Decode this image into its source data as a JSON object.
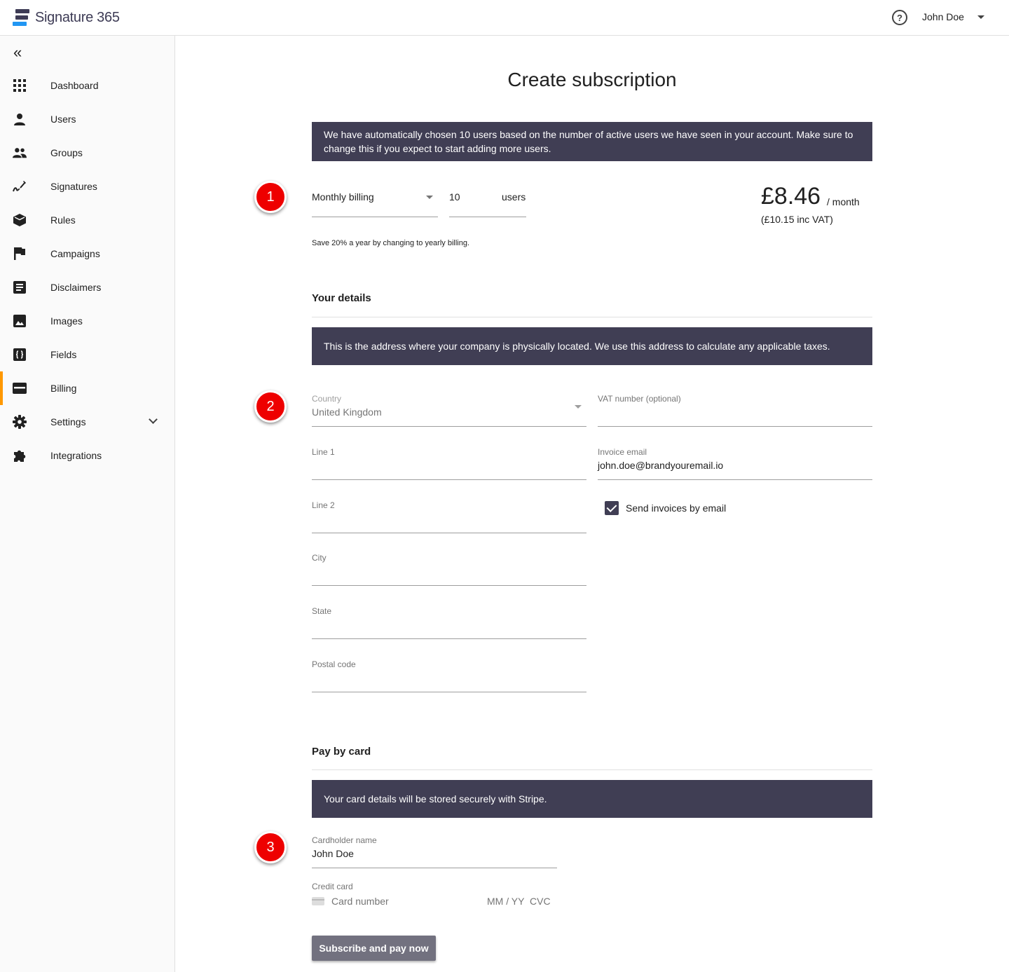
{
  "app": {
    "name": "Signature 365"
  },
  "header": {
    "user_name": "John Doe",
    "help_glyph": "?"
  },
  "sidebar": {
    "collapse_glyph": "«",
    "items": [
      {
        "label": "Dashboard",
        "icon": "grid-icon"
      },
      {
        "label": "Users",
        "icon": "person-icon"
      },
      {
        "label": "Groups",
        "icon": "people-icon"
      },
      {
        "label": "Signatures",
        "icon": "signature-icon"
      },
      {
        "label": "Rules",
        "icon": "box-icon"
      },
      {
        "label": "Campaigns",
        "icon": "flag-icon"
      },
      {
        "label": "Disclaimers",
        "icon": "document-icon"
      },
      {
        "label": "Images",
        "icon": "image-icon"
      },
      {
        "label": "Fields",
        "icon": "braces-icon"
      },
      {
        "label": "Billing",
        "icon": "credit-card-icon",
        "active": true
      },
      {
        "label": "Settings",
        "icon": "gear-icon",
        "expandable": true
      },
      {
        "label": "Integrations",
        "icon": "puzzle-icon"
      }
    ],
    "active_accent": "#ff9800"
  },
  "page": {
    "title": "Create subscription",
    "steps": [
      "1",
      "2",
      "3"
    ],
    "users_banner": "We have automatically chosen 10 users based on the number of active users we have seen in your account. Make sure to change this if you expect to start adding more users.",
    "billing": {
      "period_value": "Monthly billing",
      "users_count": "10",
      "users_suffix": "users",
      "price": "£8.46",
      "per_month": "/ month",
      "inc_vat": "(£10.15 inc VAT)",
      "save_note": "Save 20% a year by changing to yearly billing."
    },
    "details": {
      "title": "Your details",
      "banner": "This is the address where your company is physically located. We use this address to calculate any applicable taxes.",
      "country_label": "Country",
      "country_value": "United Kingdom",
      "vat_label": "VAT number (optional)",
      "line1_label": "Line 1",
      "invoice_email_label": "Invoice email",
      "invoice_email_value": "john.doe@brandyouremail.io",
      "line2_label": "Line 2",
      "send_invoices_label": "Send invoices by email",
      "send_invoices_checked": true,
      "city_label": "City",
      "state_label": "State",
      "postal_label": "Postal code"
    },
    "payment": {
      "title": "Pay by card",
      "banner": "Your card details will be stored securely with Stripe.",
      "cardholder_label": "Cardholder name",
      "cardholder_value": "John Doe",
      "credit_card_label": "Credit card",
      "card_number_placeholder": "Card number",
      "expiry_placeholder": "MM / YY",
      "cvc_placeholder": "CVC",
      "submit_label": "Subscribe and pay now"
    }
  },
  "colors": {
    "banner_bg": "#403e54",
    "step_badge": "#ee0000",
    "button_bg": "#72717f"
  }
}
